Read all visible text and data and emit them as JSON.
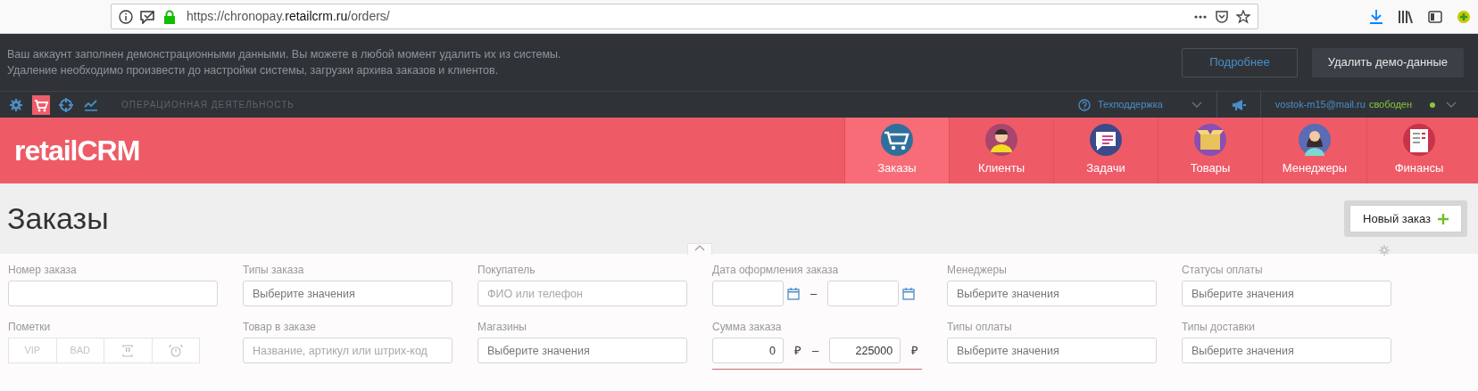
{
  "browser": {
    "url": {
      "before": "https://chronopay.",
      "domain": "retailcrm.ru",
      "after": "/orders/"
    }
  },
  "banner": {
    "lines": [
      "Ваш аккаунт заполнен демонстрационными данными. Вы можете в любой момент удалить их из системы.",
      "Удаление необходимо произвести до настройки системы, загрузки архива заказов и клиентов."
    ],
    "buttons": [
      {
        "label": "Подробнее",
        "kind": "outline"
      },
      {
        "label": "Удалить демо-данные",
        "kind": "solid"
      }
    ]
  },
  "toolbar": {
    "icons": [
      {
        "kind": "gear",
        "selected": false
      },
      {
        "kind": "cart",
        "selected": true
      },
      {
        "kind": "target",
        "selected": false
      },
      {
        "kind": "chart",
        "selected": false
      }
    ],
    "section": "ОПЕРАЦИОННАЯ ДЕЯТЕЛЬНОСТЬ",
    "support": "Техподдержка",
    "user_email": "vostok-m15@mail.ru",
    "user_status": "свободен",
    "online": true
  },
  "header": {
    "logo": "retailCRM",
    "nav": [
      {
        "label": "Заказы",
        "kind": "cart",
        "selected": true
      },
      {
        "label": "Клиенты",
        "kind": "client",
        "selected": false
      },
      {
        "label": "Задачи",
        "kind": "tasks",
        "selected": false
      },
      {
        "label": "Товары",
        "kind": "box",
        "selected": false
      },
      {
        "label": "Менеджеры",
        "kind": "manager",
        "selected": false
      },
      {
        "label": "Финансы",
        "kind": "ledger",
        "selected": false
      }
    ]
  },
  "page": {
    "title": "Заказы",
    "new_button": "Новый заказ"
  },
  "filters": [
    {
      "kind": "text",
      "label": "Номер заказа"
    },
    {
      "kind": "select",
      "label": "Типы заказа",
      "placeholder": "Выберите значения"
    },
    {
      "kind": "text",
      "label": "Покупатель",
      "placeholder": "ФИО или телефон"
    },
    {
      "kind": "dates",
      "label": "Дата оформления заказа",
      "separator": "–"
    },
    {
      "kind": "select",
      "label": "Менеджеры",
      "placeholder": "Выберите значения"
    },
    {
      "kind": "select",
      "label": "Статусы оплаты",
      "placeholder": "Выберите значения"
    },
    {
      "kind": "marks",
      "label": "Пометки",
      "marks": [
        {
          "kind": "text",
          "label": "VIP",
          "selected": false
        },
        {
          "kind": "text",
          "label": "BAD",
          "selected": false
        },
        {
          "kind": "alert",
          "selected": false
        },
        {
          "kind": "clock",
          "selected": false
        }
      ]
    },
    {
      "kind": "text",
      "label": "Товар в заказе",
      "placeholder": "Название, артикул или штрих-код"
    },
    {
      "kind": "select",
      "label": "Магазины",
      "placeholder": "Выберите значения"
    },
    {
      "kind": "range",
      "label": "Сумма заказа",
      "from": "0",
      "to": "225000",
      "currency": "₽",
      "separator": "–",
      "highlighted": true
    },
    {
      "kind": "select",
      "label": "Типы оплаты",
      "placeholder": "Выберите значения"
    },
    {
      "kind": "select",
      "label": "Типы доставки",
      "placeholder": "Выберите значения"
    }
  ]
}
